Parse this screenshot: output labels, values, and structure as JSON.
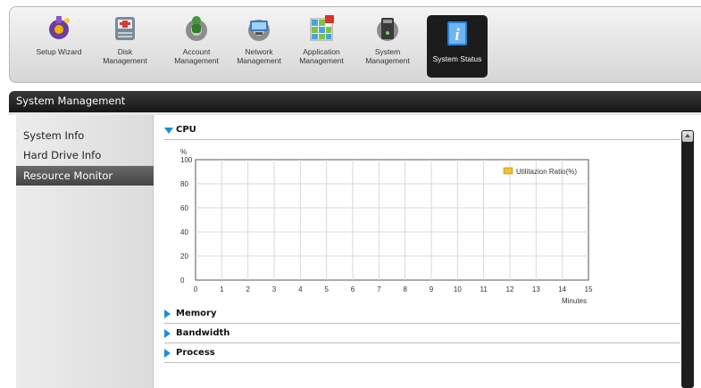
{
  "toolbar": {
    "items": [
      {
        "label": "Setup Wizard",
        "icon": "wizard-icon"
      },
      {
        "label": "Disk\nManagement",
        "icon": "disk-icon"
      },
      {
        "label": "Account\nManagement",
        "icon": "account-icon"
      },
      {
        "label": "Network\nManagement",
        "icon": "network-icon"
      },
      {
        "label": "Application\nManagement",
        "icon": "application-icon"
      },
      {
        "label": "System\nManagement",
        "icon": "system-icon"
      },
      {
        "label": "System Status",
        "icon": "info-icon",
        "active": true
      }
    ]
  },
  "section": {
    "title": "System Management"
  },
  "sidebar": {
    "items": [
      {
        "label": "System Info"
      },
      {
        "label": "Hard Drive Info"
      },
      {
        "label": "Resource Monitor",
        "active": true
      }
    ]
  },
  "panels": {
    "cpu": "CPU",
    "memory": "Memory",
    "bandwidth": "Bandwidth",
    "process": "Process"
  },
  "colors": {
    "accent_blue": "#1a8fd6",
    "legend_swatch": "#f0c030",
    "header_dark": "#1c1c1c"
  },
  "chart_data": {
    "type": "line",
    "unit_label": "%",
    "xlabel": "Minutes",
    "x_ticks": [
      0,
      1,
      2,
      3,
      4,
      5,
      6,
      7,
      8,
      9,
      10,
      11,
      12,
      13,
      14,
      15
    ],
    "y_ticks": [
      0,
      20,
      40,
      60,
      80,
      100
    ],
    "xlim": [
      0,
      15
    ],
    "ylim": [
      0,
      100
    ],
    "grid": true,
    "legend_position": "top-right",
    "series": [
      {
        "name": "Utilitazion Ratio(%)",
        "color": "#f0c030",
        "values": []
      }
    ]
  }
}
